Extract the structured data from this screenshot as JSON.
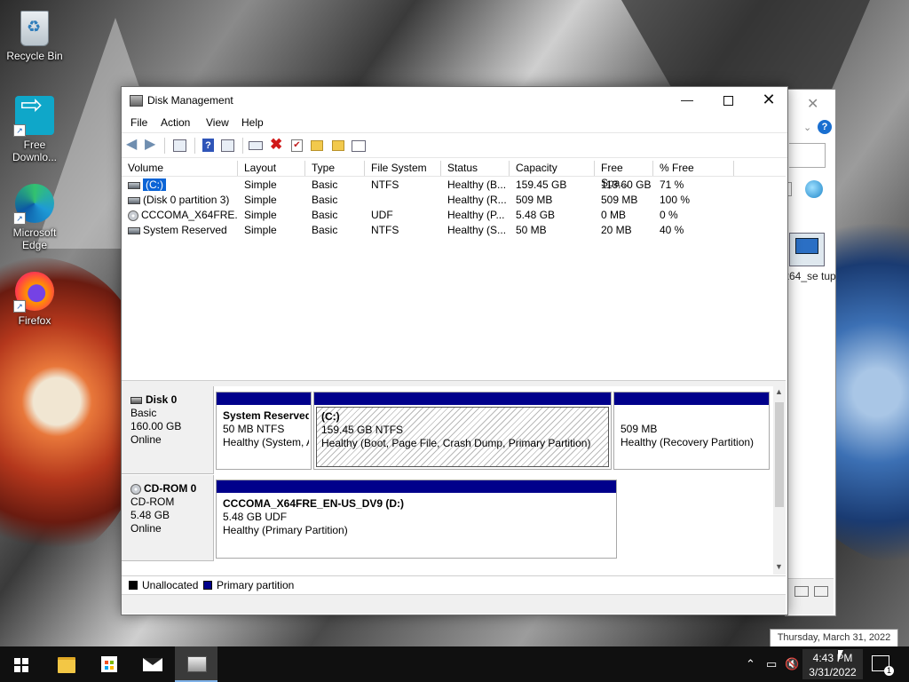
{
  "desktop": {
    "icons": [
      {
        "label": "Recycle Bin"
      },
      {
        "label": "Free Downlo..."
      },
      {
        "label": "Microsoft Edge"
      },
      {
        "label": "Firefox"
      },
      {
        "label": "_x64_se tup"
      }
    ]
  },
  "window": {
    "title": "Disk Management",
    "menu": [
      "File",
      "Action",
      "View",
      "Help"
    ],
    "columns": [
      "Volume",
      "Layout",
      "Type",
      "File System",
      "Status",
      "Capacity",
      "Free Spa...",
      "% Free"
    ],
    "volumes": [
      {
        "volume": "(C:)",
        "layout": "Simple",
        "type": "Basic",
        "fs": "NTFS",
        "status": "Healthy (B...",
        "capacity": "159.45 GB",
        "free": "113.60 GB",
        "pct": "71 %"
      },
      {
        "volume": "(Disk 0 partition 3)",
        "layout": "Simple",
        "type": "Basic",
        "fs": "",
        "status": "Healthy (R...",
        "capacity": "509 MB",
        "free": "509 MB",
        "pct": "100 %"
      },
      {
        "volume": "CCCOMA_X64FRE...",
        "layout": "Simple",
        "type": "Basic",
        "fs": "UDF",
        "status": "Healthy (P...",
        "capacity": "5.48 GB",
        "free": "0 MB",
        "pct": "0 %"
      },
      {
        "volume": "System Reserved",
        "layout": "Simple",
        "type": "Basic",
        "fs": "NTFS",
        "status": "Healthy (S...",
        "capacity": "50 MB",
        "free": "20 MB",
        "pct": "40 %"
      }
    ],
    "disks": [
      {
        "name": "Disk 0",
        "type": "Basic",
        "size": "160.00 GB",
        "state": "Online",
        "partitions": [
          {
            "name": "System Reserved",
            "detail": "50 MB NTFS",
            "status": "Healthy (System, Active, Primary Partition)"
          },
          {
            "name": "(C:)",
            "detail": "159.45 GB NTFS",
            "status": "Healthy (Boot, Page File, Crash Dump, Primary Partition)"
          },
          {
            "name": "",
            "detail": "509 MB",
            "status": "Healthy (Recovery Partition)"
          }
        ]
      },
      {
        "name": "CD-ROM 0",
        "type": "CD-ROM",
        "size": "5.48 GB",
        "state": "Online",
        "partitions": [
          {
            "name": "CCCOMA_X64FRE_EN-US_DV9  (D:)",
            "detail": "5.48 GB UDF",
            "status": "Healthy (Primary Partition)"
          }
        ]
      }
    ],
    "legend": {
      "unallocated": "Unallocated",
      "primary": "Primary partition"
    },
    "colors": {
      "primary_band": "#00008b",
      "unallocated": "#000000",
      "selection": "#0b64d6"
    }
  },
  "tooltip": "Thursday, March 31, 2022",
  "taskbar": {
    "time": "4:43 PM",
    "date": "3/31/2022",
    "notification_count": "1"
  }
}
